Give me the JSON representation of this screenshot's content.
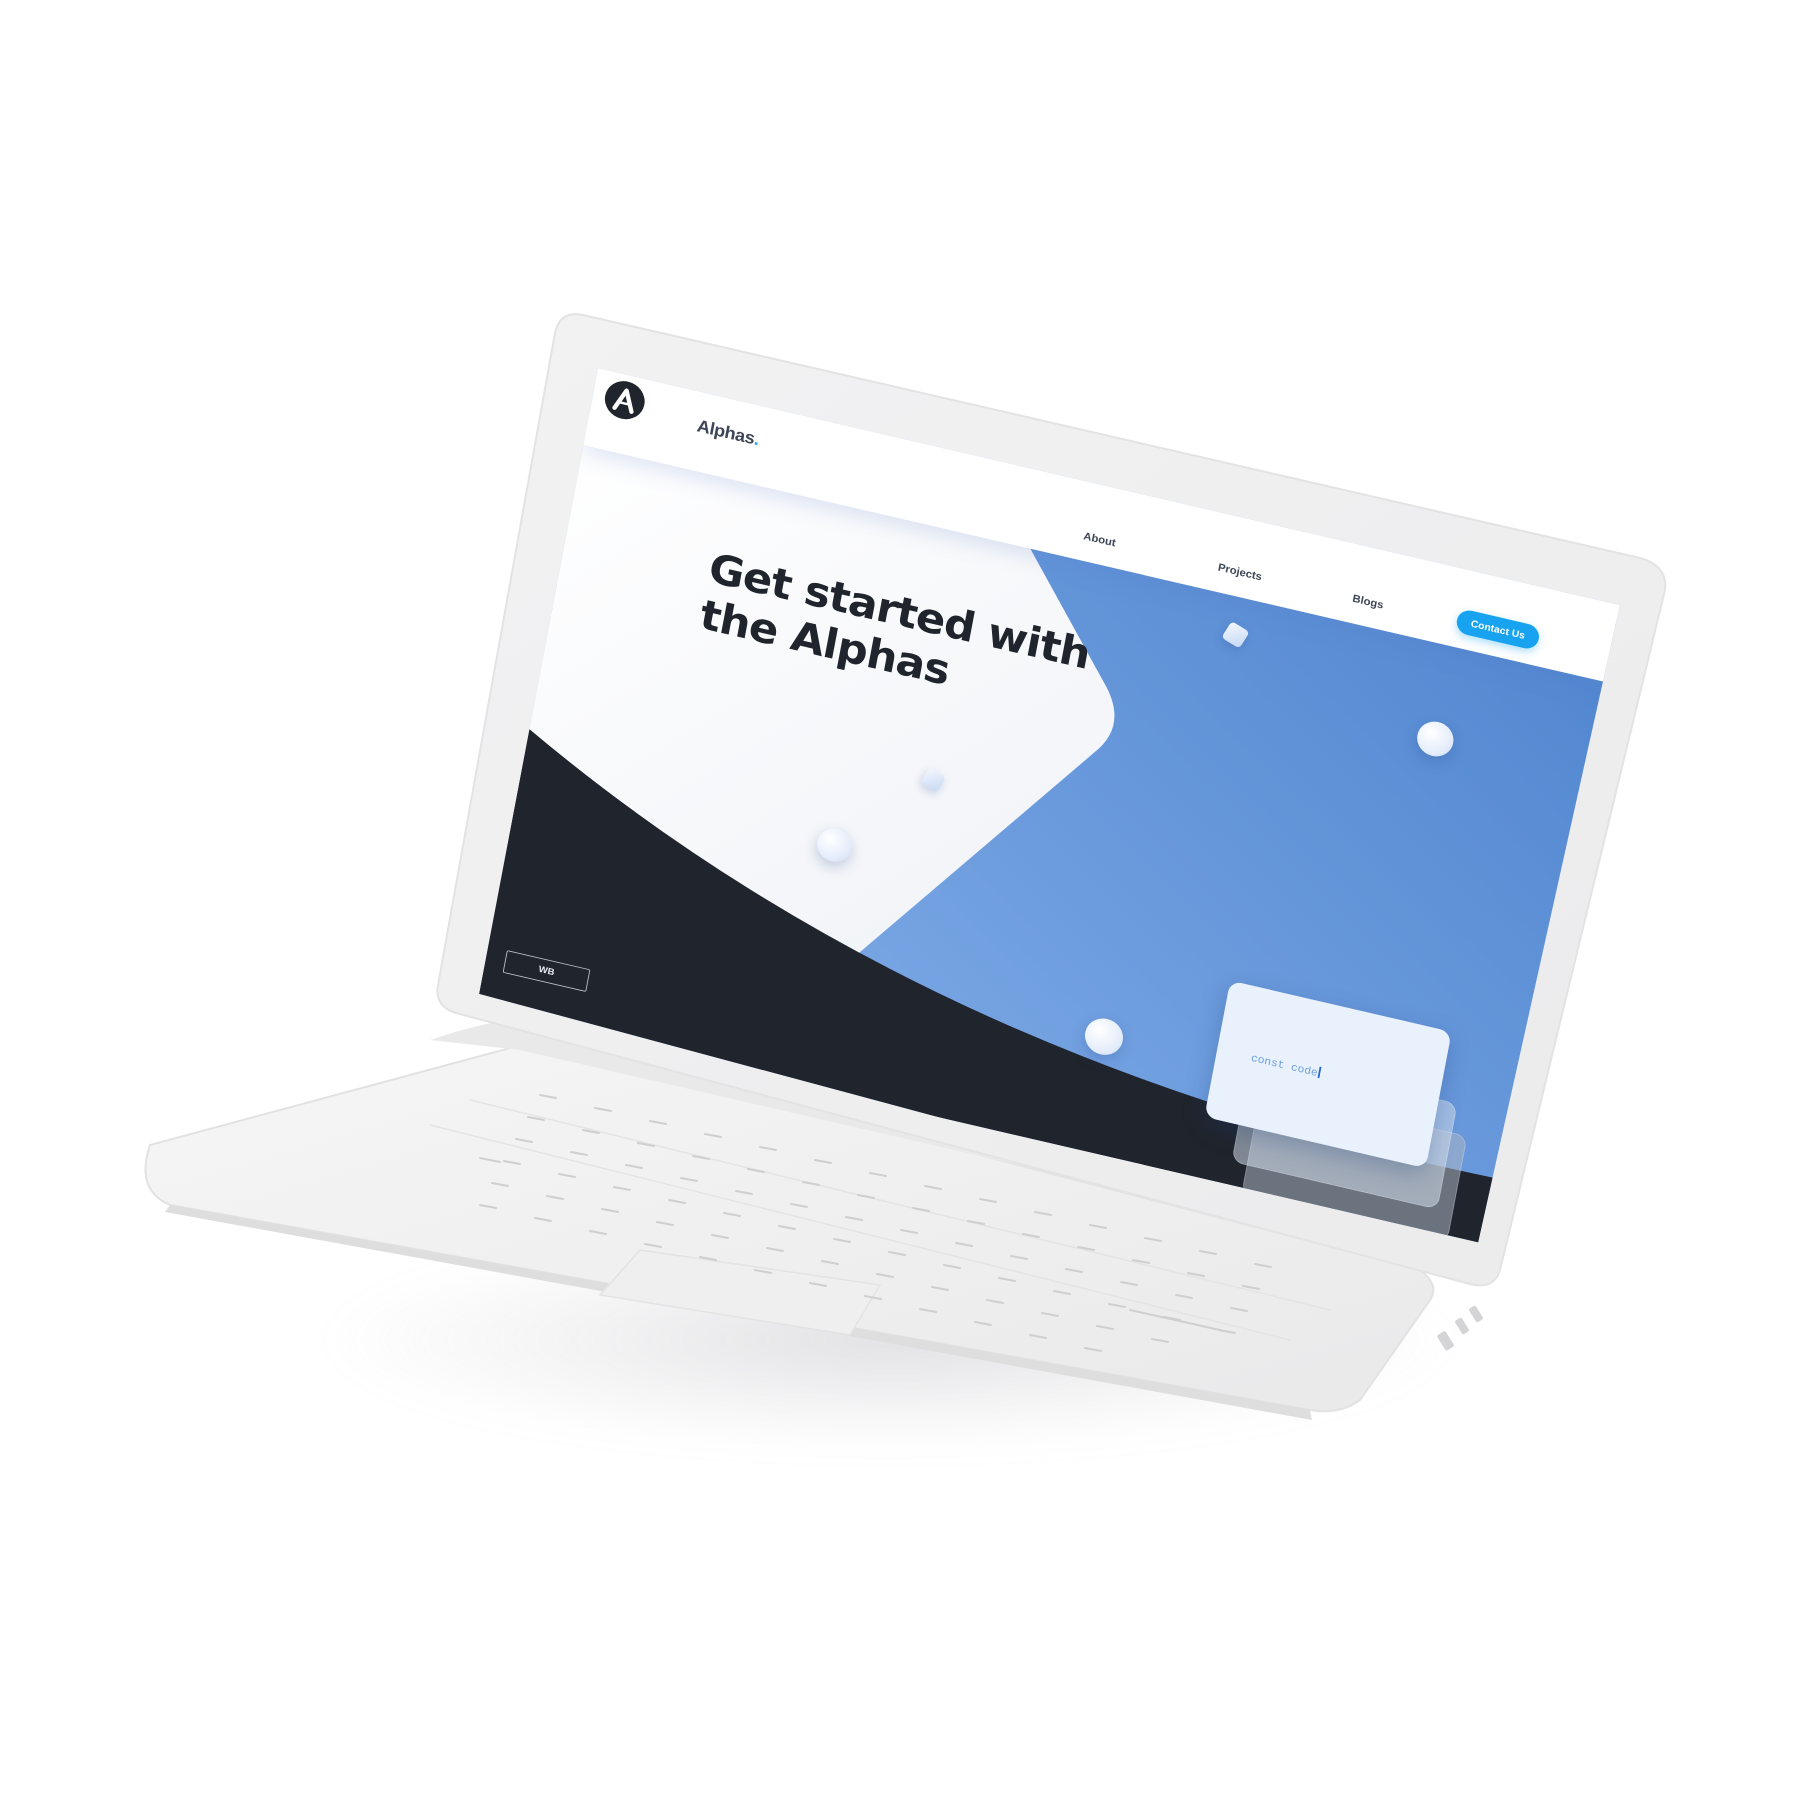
{
  "site": {
    "brand": {
      "name": "Alphas",
      "dot": "."
    },
    "nav": {
      "about": "About",
      "projects": "Projects",
      "blogs": "Blogs",
      "contact": "Contact Us"
    },
    "hero": {
      "title_line1": "Get started with",
      "title_line2": "the Alphas"
    },
    "code_card": {
      "text": "const code"
    },
    "footer_badge": "WB"
  },
  "colors": {
    "accent": "#18a3f0",
    "hero_blue": "#5b8fd6",
    "dark": "#20242c",
    "card": "#e8f1fc"
  },
  "icons": {
    "logo": "letter-a-logo-icon"
  }
}
